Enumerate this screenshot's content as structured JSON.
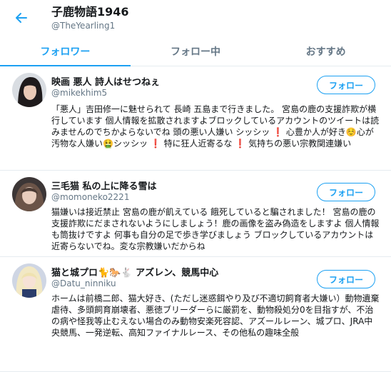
{
  "header": {
    "title": "子鹿物語1946",
    "handle": "@TheYearling1"
  },
  "tabs": [
    {
      "label": "フォロワー"
    },
    {
      "label": "フォロー中"
    },
    {
      "label": "おすすめ"
    }
  ],
  "follow_label": "フォロー",
  "users": [
    {
      "name": "映画 悪人 詩人はせつねぇ",
      "handle": "@mikekhim5",
      "bio": "「悪人」吉田修一に魅せられて 長崎 五島まで行きました。 宮島の鹿の支援詐欺が横行しています 個人情報を拡散されますよブロックしているアカウントのツイートは読みませんのでちかよらないでね 頭の悪い人嫌い シッシッ ❗ 心豊か人が好き☺️心が汚物な人嫌い🤮シッシッ ❗ 特に狂人近寄るな ❗ 気持ちの悪い宗教関連嫌い"
    },
    {
      "name": "三毛猫 私の上に降る雪は",
      "handle": "@momoneko2221",
      "bio": "猫嫌いは接近禁止 宮島の鹿が飢えている 餓死していると騙されました！ 宮島の鹿の支援詐欺にだまされないようにしましょう！鹿の画像を盗み偽造をしますよ 個人情報も筒抜けですよ 何事も自分の足で歩き学びましょう ブロックしているアカウントは近寄らないでね。変な宗教嫌いだからね"
    },
    {
      "name": "猫と城プロ🐈🐎🐇 アズレン、競馬中心",
      "handle": "@Datu_ninniku",
      "bio": "ホームは前橋二郎、猫大好き、(ただし迷惑餌やり及び不適切飼育者大嫌い）動物遺棄虐待、多頭飼育崩壊者、悪徳ブリーダーらに厳罰を、動物殺処分0を目指すが、不治の病や怪我等止むえない場合のみ動物安楽死容認、アズールレーン、城プロ、JRA中央競馬、一発逆転、高知ファイナルレース、その他私の趣味全般"
    }
  ],
  "colors": {
    "accent": "#1da1f2",
    "text": "#14171a",
    "muted": "#657786",
    "border": "#e6ecf0"
  }
}
